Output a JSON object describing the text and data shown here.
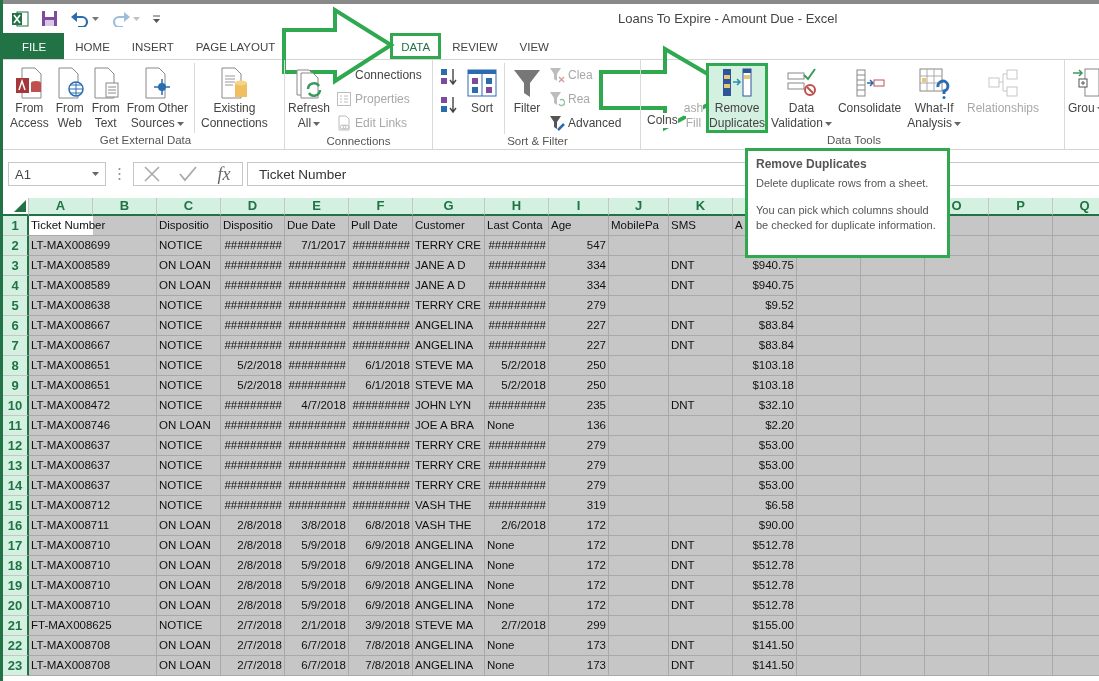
{
  "title_bar": {
    "title": "Loans To Expire - Amount Due - Excel",
    "quick_access": [
      {
        "kind": "logo",
        "disabled": false
      },
      {
        "kind": "save",
        "disabled": false
      },
      {
        "kind": "undo",
        "disabled": false,
        "dropdown": true
      },
      {
        "kind": "redo",
        "disabled": true,
        "dropdown": true
      },
      {
        "kind": "customize",
        "disabled": false
      }
    ]
  },
  "tabs": [
    {
      "label": "FILE",
      "kind": "file",
      "selected": false,
      "outlined": false
    },
    {
      "label": "HOME",
      "kind": "tab",
      "selected": false,
      "outlined": false
    },
    {
      "label": "INSERT",
      "kind": "tab",
      "selected": false,
      "outlined": false
    },
    {
      "label": "PAGE LAYOUT",
      "kind": "tab",
      "selected": false,
      "outlined": false
    },
    {
      "kind": "covered"
    },
    {
      "label": "DATA",
      "kind": "tab",
      "selected": true,
      "outlined": true
    },
    {
      "label": "REVIEW",
      "kind": "tab",
      "selected": false,
      "outlined": false
    },
    {
      "label": "VIEW",
      "kind": "tab",
      "selected": false,
      "outlined": false
    }
  ],
  "ribbon": {
    "groups": [
      {
        "label": "Get External Data",
        "items": [
          {
            "kind": "large",
            "lines": [
              "From",
              "Access"
            ],
            "disabled": false,
            "dropdown": false
          },
          {
            "kind": "large",
            "lines": [
              "From",
              "Web"
            ],
            "disabled": false,
            "dropdown": false
          },
          {
            "kind": "large",
            "lines": [
              "From",
              "Text"
            ],
            "disabled": false,
            "dropdown": false
          },
          {
            "kind": "large",
            "lines": [
              "From Other",
              "Sources"
            ],
            "disabled": false,
            "dropdown": true
          },
          {
            "kind": "separator"
          },
          {
            "kind": "large",
            "lines": [
              "Existing",
              "Connections"
            ],
            "disabled": false,
            "dropdown": false
          }
        ]
      },
      {
        "label": "Connections",
        "items": [
          {
            "kind": "large",
            "lines": [
              "Refresh",
              "All"
            ],
            "disabled": false,
            "dropdown": true
          },
          {
            "kind": "stack",
            "items": [
              {
                "kind": "small",
                "label": "Connections",
                "disabled": false
              },
              {
                "kind": "small",
                "label": "Properties",
                "disabled": true
              },
              {
                "kind": "small",
                "label": "Edit Links",
                "disabled": true
              }
            ]
          }
        ]
      },
      {
        "label": "Sort & Filter",
        "items": [
          {
            "kind": "stack",
            "items": [
              {
                "kind": "icon",
                "disabled": false
              },
              {
                "kind": "icon",
                "disabled": false
              }
            ]
          },
          {
            "kind": "large",
            "lines": [
              "Sort"
            ],
            "disabled": false,
            "dropdown": false
          },
          {
            "kind": "separator"
          },
          {
            "kind": "large",
            "lines": [
              "Filter"
            ],
            "disabled": false,
            "dropdown": false
          },
          {
            "kind": "stack",
            "items": [
              {
                "kind": "small",
                "label": "Clea",
                "disabled": true
              },
              {
                "kind": "small",
                "label": "Rea",
                "disabled": true
              },
              {
                "kind": "small",
                "label": "Advanced",
                "disabled": false
              }
            ]
          }
        ]
      },
      {
        "label": "Data Tools",
        "items": [
          {
            "kind": "split",
            "texts": [
              "Col",
              "ns"
            ],
            "disabled": false
          },
          {
            "kind": "large",
            "lines": [
              "ash",
              "Fill"
            ],
            "disabled": true,
            "dropdown": false
          },
          {
            "kind": "large",
            "lines": [
              "Remove",
              "Duplicates"
            ],
            "disabled": false,
            "dropdown": false,
            "hovered": true,
            "outlined": true
          },
          {
            "kind": "large",
            "lines": [
              "Data",
              "Validation"
            ],
            "disabled": false,
            "dropdown": true
          },
          {
            "kind": "large",
            "lines": [
              "Consolidate"
            ],
            "disabled": false,
            "dropdown": false
          },
          {
            "kind": "large",
            "lines": [
              "What-If",
              "Analysis"
            ],
            "disabled": false,
            "dropdown": true
          },
          {
            "kind": "large",
            "lines": [
              "Relationships"
            ],
            "disabled": true,
            "dropdown": false
          }
        ]
      },
      {
        "items": [
          {
            "kind": "large",
            "lines": [
              "Grou"
            ],
            "disabled": false,
            "dropdown": true
          }
        ]
      }
    ]
  },
  "formula_bar": {
    "name_box": "A1",
    "function_label": "fx",
    "formula": "Ticket Number"
  },
  "sheet": {
    "all_selected": true,
    "columns": [
      "A",
      "B",
      "C",
      "D",
      "E",
      "F",
      "G",
      "H",
      "I",
      "J",
      "K",
      null,
      null,
      null,
      "O",
      "P",
      "Q"
    ],
    "rows": [
      {
        "number": "1",
        "active": true,
        "cells": [
          "Ticket Number",
          null,
          "Dispositio",
          "Dispositio",
          "Due Date",
          "Pull Date",
          "Customer",
          "Last Conta",
          "Age",
          "MobilePa",
          "SMS",
          "A"
        ]
      },
      {
        "number": "2",
        "active": false,
        "cells": [
          "LT-MAX008699",
          null,
          "NOTICE",
          "#########",
          "7/1/2017",
          "#########",
          "TERRY CRE",
          "#########",
          "547"
        ]
      },
      {
        "number": "3",
        "active": false,
        "cells": [
          "LT-MAX008589",
          null,
          "ON LOAN",
          "#########",
          "#########",
          "#########",
          "JANE A D",
          "#########",
          "334",
          null,
          "DNT",
          "$940.75"
        ]
      },
      {
        "number": "4",
        "active": false,
        "cells": [
          "LT-MAX008589",
          null,
          "ON LOAN",
          "#########",
          "#########",
          "#########",
          "JANE A D",
          "#########",
          "334",
          null,
          "DNT",
          "$940.75"
        ]
      },
      {
        "number": "5",
        "active": false,
        "cells": [
          "LT-MAX008638",
          null,
          "NOTICE",
          "#########",
          "#########",
          "#########",
          "TERRY CRE",
          "#########",
          "279",
          null,
          null,
          "$9.52"
        ]
      },
      {
        "number": "6",
        "active": false,
        "cells": [
          "LT-MAX008667",
          null,
          "NOTICE",
          "#########",
          "#########",
          "#########",
          "ANGELINA",
          "#########",
          "227",
          null,
          "DNT",
          "$83.84"
        ]
      },
      {
        "number": "7",
        "active": false,
        "cells": [
          "LT-MAX008667",
          null,
          "NOTICE",
          "#########",
          "#########",
          "#########",
          "ANGELINA",
          "#########",
          "227",
          null,
          "DNT",
          "$83.84"
        ]
      },
      {
        "number": "8",
        "active": false,
        "cells": [
          "LT-MAX008651",
          null,
          "NOTICE",
          "5/2/2018",
          "#########",
          "6/1/2018",
          "STEVE MA",
          "5/2/2018",
          "250",
          null,
          null,
          "$103.18"
        ]
      },
      {
        "number": "9",
        "active": false,
        "cells": [
          "LT-MAX008651",
          null,
          "NOTICE",
          "5/2/2018",
          "#########",
          "6/1/2018",
          "STEVE MA",
          "5/2/2018",
          "250",
          null,
          null,
          "$103.18"
        ]
      },
      {
        "number": "10",
        "active": false,
        "cells": [
          "LT-MAX008472",
          null,
          "NOTICE",
          "#########",
          "4/7/2018",
          "#########",
          "JOHN LYN",
          "#########",
          "235",
          null,
          "DNT",
          "$32.10"
        ]
      },
      {
        "number": "11",
        "active": false,
        "cells": [
          "LT-MAX008746",
          null,
          "ON LOAN",
          "#########",
          "#########",
          "#########",
          "JOE A BRA",
          "None",
          "136",
          null,
          null,
          "$2.20"
        ]
      },
      {
        "number": "12",
        "active": false,
        "cells": [
          "LT-MAX008637",
          null,
          "NOTICE",
          "#########",
          "#########",
          "#########",
          "TERRY CRE",
          "#########",
          "279",
          null,
          null,
          "$53.00"
        ]
      },
      {
        "number": "13",
        "active": false,
        "cells": [
          "LT-MAX008637",
          null,
          "NOTICE",
          "#########",
          "#########",
          "#########",
          "TERRY CRE",
          "#########",
          "279",
          null,
          null,
          "$53.00"
        ]
      },
      {
        "number": "14",
        "active": false,
        "cells": [
          "LT-MAX008637",
          null,
          "NOTICE",
          "#########",
          "#########",
          "#########",
          "TERRY CRE",
          "#########",
          "279",
          null,
          null,
          "$53.00"
        ]
      },
      {
        "number": "15",
        "active": false,
        "cells": [
          "LT-MAX008712",
          null,
          "NOTICE",
          "#########",
          "#########",
          "#########",
          "VASH THE",
          "#########",
          "319",
          null,
          null,
          "$6.58"
        ]
      },
      {
        "number": "16",
        "active": false,
        "cells": [
          "LT-MAX008711",
          null,
          "ON LOAN",
          "2/8/2018",
          "3/8/2018",
          "6/8/2018",
          "VASH THE",
          "2/6/2018",
          "172",
          null,
          null,
          "$90.00"
        ]
      },
      {
        "number": "17",
        "active": false,
        "cells": [
          "LT-MAX008710",
          null,
          "ON LOAN",
          "2/8/2018",
          "5/9/2018",
          "6/9/2018",
          "ANGELINA",
          "None",
          "172",
          null,
          "DNT",
          "$512.78"
        ]
      },
      {
        "number": "18",
        "active": false,
        "cells": [
          "LT-MAX008710",
          null,
          "ON LOAN",
          "2/8/2018",
          "5/9/2018",
          "6/9/2018",
          "ANGELINA",
          "None",
          "172",
          null,
          "DNT",
          "$512.78"
        ]
      },
      {
        "number": "19",
        "active": false,
        "cells": [
          "LT-MAX008710",
          null,
          "ON LOAN",
          "2/8/2018",
          "5/9/2018",
          "6/9/2018",
          "ANGELINA",
          "None",
          "172",
          null,
          "DNT",
          "$512.78"
        ]
      },
      {
        "number": "20",
        "active": false,
        "cells": [
          "LT-MAX008710",
          null,
          "ON LOAN",
          "2/8/2018",
          "5/9/2018",
          "6/9/2018",
          "ANGELINA",
          "None",
          "172",
          null,
          "DNT",
          "$512.78"
        ]
      },
      {
        "number": "21",
        "active": false,
        "cells": [
          "FT-MAX008625",
          null,
          "NOTICE",
          "2/7/2018",
          "2/1/2018",
          "3/9/2018",
          "STEVE MA",
          "2/7/2018",
          "299",
          null,
          null,
          "$155.00"
        ]
      },
      {
        "number": "22",
        "active": false,
        "cells": [
          "LT-MAX008708",
          null,
          "ON LOAN",
          "2/7/2018",
          "6/7/2018",
          "7/8/2018",
          "ANGELINA",
          "None",
          "173",
          null,
          "DNT",
          "$141.50"
        ]
      },
      {
        "number": "23",
        "active": false,
        "cells": [
          "LT-MAX008708",
          null,
          "ON LOAN",
          "2/7/2018",
          "6/7/2018",
          "7/8/2018",
          "ANGELINA",
          "None",
          "173",
          null,
          "DNT",
          "$141.50"
        ]
      }
    ]
  },
  "tooltip": {
    "title": "Remove Duplicates",
    "paragraphs": [
      "Delete duplicate rows from a sheet.",
      "You can pick which columns should be checked for duplicate information."
    ],
    "outlined": true
  },
  "annotation_arrows": [
    {
      "kind": "arrow"
    },
    {
      "kind": "arrow"
    }
  ]
}
